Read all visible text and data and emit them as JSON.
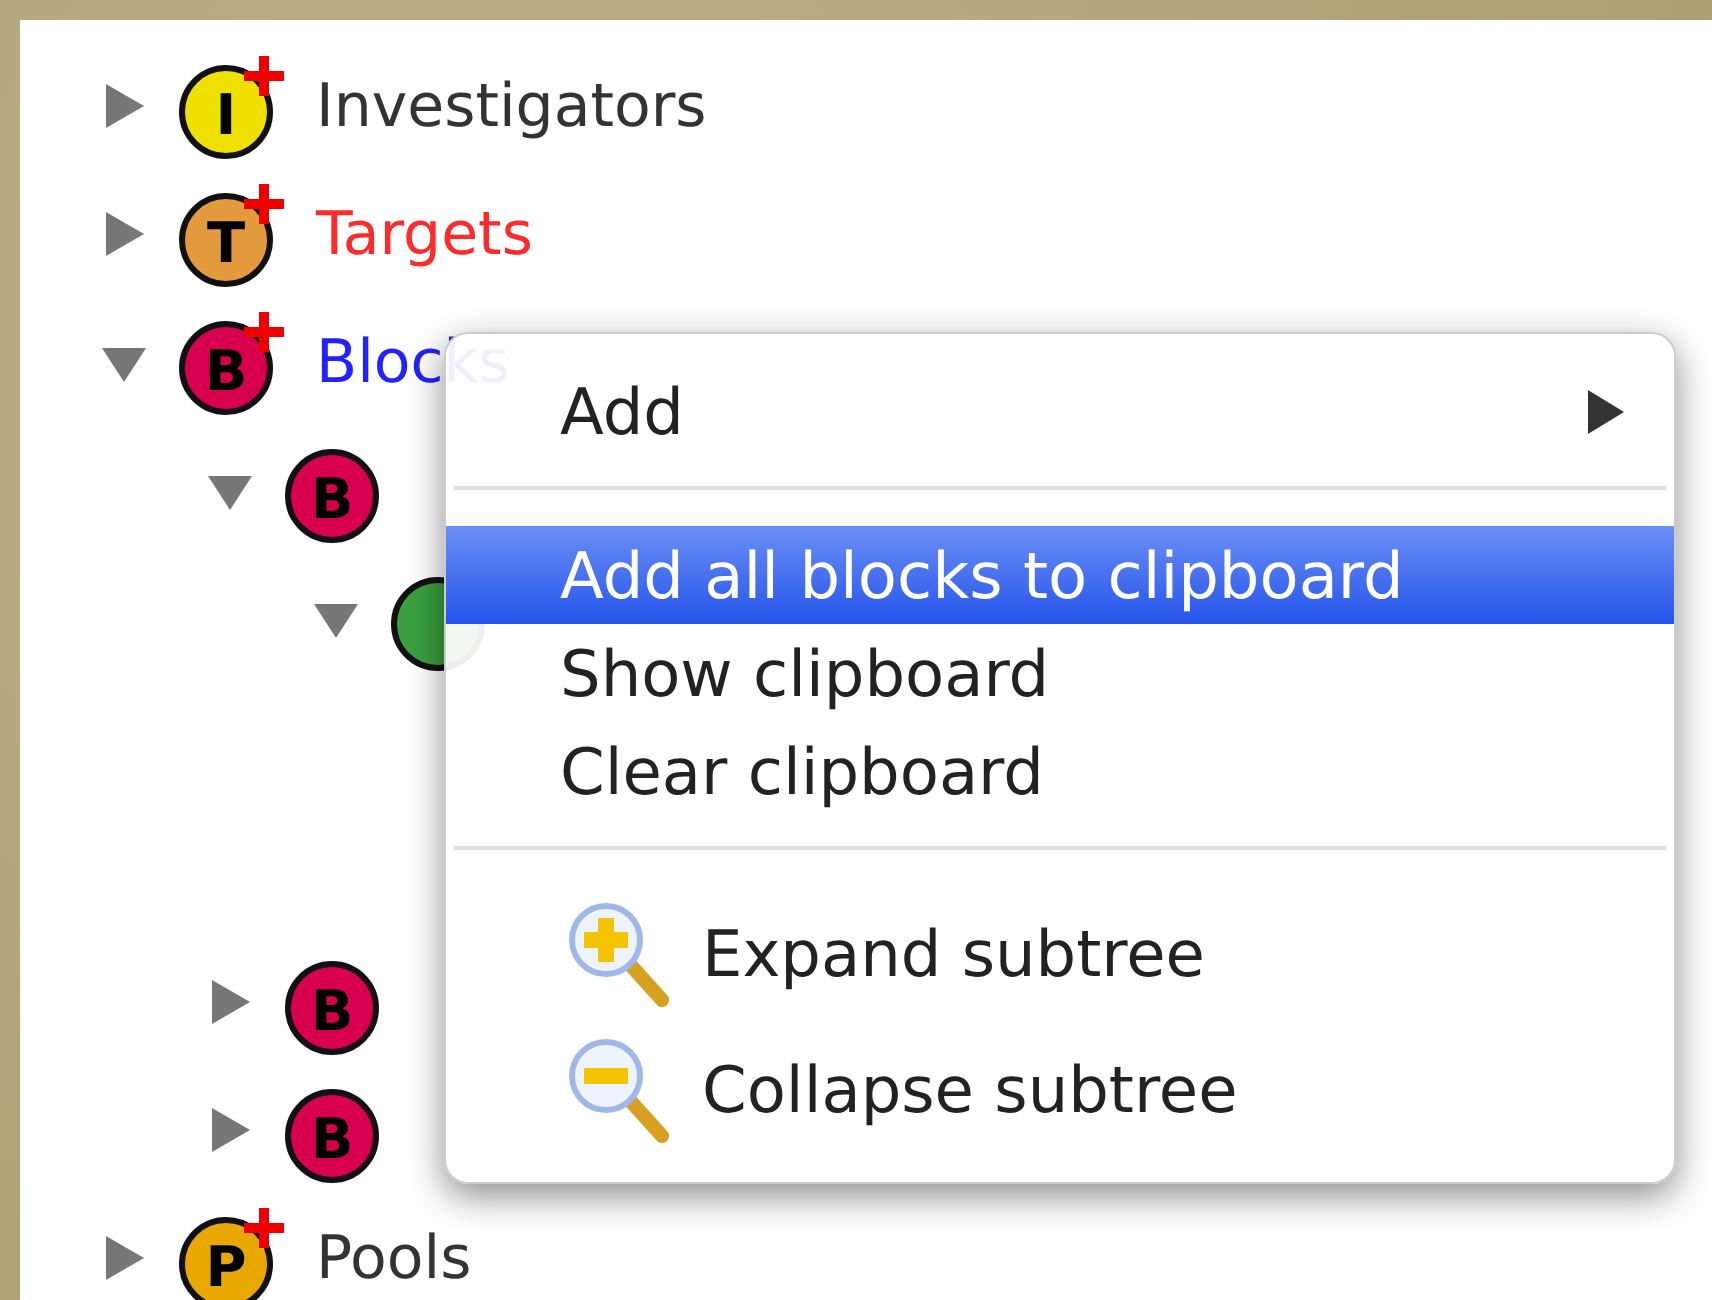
{
  "tree": [
    {
      "label": {
        "text": "Investigators",
        "color": "#333333"
      },
      "icon": {
        "letter": "I",
        "color": "#f0e000"
      },
      "addable": true,
      "expanded": false
    },
    {
      "label": {
        "text": "Targets",
        "color": "#ff2a2a"
      },
      "icon": {
        "letter": "T",
        "color": "#e39a3c"
      },
      "addable": true,
      "expanded": false
    },
    {
      "label": {
        "text": "Blocks",
        "color": "#2222ff"
      },
      "icon": {
        "letter": "B",
        "color": "#d8004e"
      },
      "addable": true,
      "expanded": true,
      "children": [
        {
          "icon": {
            "letter": "B",
            "color": "#d8004e"
          },
          "addable": false,
          "expanded": true,
          "children": [
            {
              "icon": {
                "color": "#3aa040"
              },
              "expanded": true
            }
          ]
        },
        {
          "icon": {
            "letter": "B",
            "color": "#d8004e"
          },
          "addable": false,
          "expanded": false
        },
        {
          "icon": {
            "letter": "B",
            "color": "#d8004e"
          },
          "addable": false,
          "expanded": false
        }
      ]
    },
    {
      "label": {
        "text": "Pools",
        "color": "#333333"
      },
      "icon": {
        "letter": "P",
        "color": "#e8a800"
      },
      "addable": true,
      "expanded": false
    }
  ],
  "context_menu": [
    {
      "kind": "item",
      "label": "Add",
      "submenu": true,
      "selected": false
    },
    {
      "kind": "separator"
    },
    {
      "kind": "item",
      "label": "Add all blocks to clipboard",
      "submenu": false,
      "selected": true
    },
    {
      "kind": "item",
      "label": "Show clipboard",
      "submenu": false,
      "selected": false
    },
    {
      "kind": "item",
      "label": "Clear clipboard",
      "submenu": false,
      "selected": false
    },
    {
      "kind": "separator"
    },
    {
      "kind": "zoom-in",
      "label": "Expand subtree",
      "submenu": false,
      "selected": false
    },
    {
      "kind": "zoom-out",
      "label": "Collapse subtree",
      "submenu": false,
      "selected": false
    }
  ]
}
